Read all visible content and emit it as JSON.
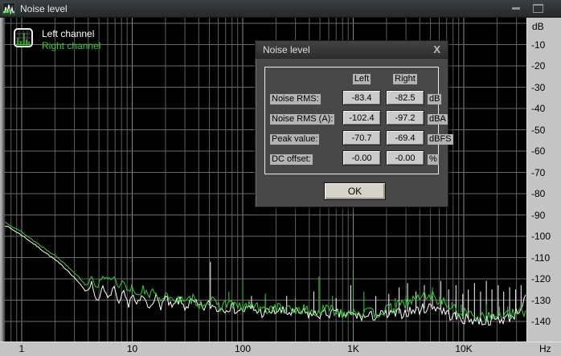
{
  "window": {
    "title": "Noise level"
  },
  "legend": {
    "left": {
      "label": "Left channel",
      "color": "#ffffff"
    },
    "right": {
      "label": "Right channel",
      "color": "#35c835"
    }
  },
  "axes": {
    "y_title": "dB",
    "y_ticks": [
      "-10",
      "-20",
      "-30",
      "-40",
      "-50",
      "-60",
      "-70",
      "-80",
      "-90",
      "-100",
      "-110",
      "-120",
      "-130",
      "-140"
    ],
    "x_ticks": [
      {
        "label": "1",
        "f": 1
      },
      {
        "label": "10",
        "f": 10
      },
      {
        "label": "100",
        "f": 100
      },
      {
        "label": "1K",
        "f": 1000
      },
      {
        "label": "10K",
        "f": 10000
      }
    ],
    "x_unit": "Hz"
  },
  "dialog": {
    "title": "Noise level",
    "close_label": "X",
    "columns": [
      "Left",
      "Right"
    ],
    "rows": [
      {
        "label": "Noise RMS:",
        "left": "-83.4",
        "right": "-82.5",
        "unit": "dB"
      },
      {
        "label": "Noise RMS (A):",
        "left": "-102.4",
        "right": "-97.2",
        "unit": "dBA"
      },
      {
        "label": "Peak value:",
        "left": "-70.7",
        "right": "-69.4",
        "unit": "dBFS"
      },
      {
        "label": "DC offset:",
        "left": "-0.00",
        "right": "-0.00",
        "unit": "%"
      }
    ],
    "ok_label": "OK"
  },
  "chart_data": {
    "type": "line",
    "title": "Noise level spectrum",
    "xlabel": "Hz",
    "ylabel": "dB",
    "x_scale": "log",
    "x_range_hz": [
      0.7,
      36500
    ],
    "y_range_db": [
      0,
      -150
    ],
    "grid": {
      "horizontal_step_db": 10,
      "vertical": "log-decades"
    },
    "legend_position": "top-left",
    "series": [
      {
        "name": "Left channel",
        "color": "#ffffff",
        "trend": [
          [
            0.72,
            -95
          ],
          [
            1,
            -99.5
          ],
          [
            1.4,
            -105
          ],
          [
            2,
            -111
          ],
          [
            2.6,
            -116
          ],
          [
            3.2,
            -121
          ],
          [
            3.8,
            -126
          ],
          [
            4.3,
            -122
          ],
          [
            4.8,
            -131
          ],
          [
            5.4,
            -124
          ],
          [
            6.1,
            -130
          ],
          [
            6.8,
            -123
          ],
          [
            7.5,
            -133
          ],
          [
            8.3,
            -126
          ],
          [
            9.2,
            -132
          ],
          [
            10,
            -127
          ],
          [
            11,
            -133
          ],
          [
            12.5,
            -128
          ],
          [
            14,
            -134
          ],
          [
            16,
            -128
          ],
          [
            18,
            -133
          ],
          [
            20,
            -129
          ],
          [
            23,
            -134
          ],
          [
            26,
            -130
          ],
          [
            30,
            -133
          ],
          [
            35,
            -131
          ],
          [
            42,
            -134
          ],
          [
            50,
            -132
          ],
          [
            60,
            -134
          ],
          [
            75,
            -133
          ],
          [
            95,
            -135
          ],
          [
            120,
            -134
          ],
          [
            150,
            -136
          ],
          [
            200,
            -135
          ],
          [
            260,
            -136
          ],
          [
            340,
            -136
          ],
          [
            450,
            -137
          ],
          [
            600,
            -136
          ],
          [
            800,
            -137
          ],
          [
            1000,
            -137
          ],
          [
            1300,
            -138
          ],
          [
            1700,
            -137
          ],
          [
            2200,
            -137
          ],
          [
            2800,
            -136
          ],
          [
            3500,
            -135
          ],
          [
            4300,
            -134
          ],
          [
            5000,
            -133
          ],
          [
            5700,
            -133
          ],
          [
            6500,
            -135
          ],
          [
            7500,
            -137
          ],
          [
            8500,
            -138
          ],
          [
            10000,
            -139
          ],
          [
            12000,
            -139
          ],
          [
            15000,
            -140
          ],
          [
            18000,
            -139
          ],
          [
            22000,
            -139
          ],
          [
            26000,
            -138
          ],
          [
            30000,
            -136
          ],
          [
            34000,
            -132
          ],
          [
            36500,
            -129
          ]
        ],
        "spikes": [
          [
            51,
            -112
          ],
          [
            120,
            -128
          ],
          [
            160,
            -129
          ],
          [
            250,
            -128
          ],
          [
            440,
            -126
          ],
          [
            700,
            -129
          ],
          [
            950,
            -123
          ],
          [
            1600,
            -128
          ],
          [
            2100,
            -127
          ],
          [
            2600,
            -124
          ],
          [
            3100,
            -122
          ],
          [
            3700,
            -126
          ],
          [
            4400,
            -123
          ],
          [
            5200,
            -127
          ],
          [
            6200,
            -121
          ],
          [
            7300,
            -125
          ],
          [
            8500,
            -123
          ],
          [
            9800,
            -127
          ],
          [
            11000,
            -125
          ],
          [
            12500,
            -122
          ],
          [
            14200,
            -126
          ],
          [
            16000,
            -121
          ],
          [
            18000,
            -125
          ],
          [
            20500,
            -123
          ],
          [
            23000,
            -126
          ],
          [
            26000,
            -124
          ],
          [
            29500,
            -125
          ],
          [
            33000,
            -123
          ]
        ]
      },
      {
        "name": "Right channel",
        "color": "#2fd02f",
        "trend": [
          [
            0.72,
            -93.5
          ],
          [
            1,
            -98
          ],
          [
            1.4,
            -103.5
          ],
          [
            2,
            -109
          ],
          [
            2.6,
            -114
          ],
          [
            3.2,
            -118.5
          ],
          [
            3.8,
            -123
          ],
          [
            4.3,
            -120
          ],
          [
            4.8,
            -124
          ],
          [
            5.4,
            -118
          ],
          [
            6.1,
            -121
          ],
          [
            6.8,
            -119
          ],
          [
            7.5,
            -125
          ],
          [
            8.3,
            -121
          ],
          [
            9.2,
            -127
          ],
          [
            10,
            -123
          ],
          [
            11,
            -128
          ],
          [
            12.5,
            -124
          ],
          [
            14,
            -129
          ],
          [
            16,
            -125
          ],
          [
            18,
            -130
          ],
          [
            20,
            -127
          ],
          [
            23,
            -131
          ],
          [
            26,
            -128
          ],
          [
            30,
            -132
          ],
          [
            35,
            -129
          ],
          [
            42,
            -132
          ],
          [
            50,
            -130
          ],
          [
            60,
            -133
          ],
          [
            75,
            -131
          ],
          [
            95,
            -134
          ],
          [
            120,
            -132
          ],
          [
            150,
            -135
          ],
          [
            200,
            -133
          ],
          [
            260,
            -135
          ],
          [
            340,
            -134
          ],
          [
            450,
            -136
          ],
          [
            600,
            -134
          ],
          [
            800,
            -136
          ],
          [
            1000,
            -135
          ],
          [
            1300,
            -136
          ],
          [
            1700,
            -136
          ],
          [
            2200,
            -134
          ],
          [
            2800,
            -132
          ],
          [
            3500,
            -130
          ],
          [
            4000,
            -128.5
          ],
          [
            4600,
            -127.5
          ],
          [
            5200,
            -128
          ],
          [
            5800,
            -129.5
          ],
          [
            6500,
            -131
          ],
          [
            7500,
            -133
          ],
          [
            8500,
            -135
          ],
          [
            10000,
            -136
          ],
          [
            12000,
            -137
          ],
          [
            15000,
            -137
          ],
          [
            18000,
            -138
          ],
          [
            22000,
            -137
          ],
          [
            26000,
            -137
          ],
          [
            30000,
            -136
          ],
          [
            34000,
            -135.5
          ],
          [
            36500,
            -135
          ]
        ],
        "spikes": [
          [
            75,
            -126
          ],
          [
            100,
            -121
          ],
          [
            160,
            -127
          ],
          [
            300,
            -129
          ],
          [
            490,
            -119
          ],
          [
            650,
            -128
          ],
          [
            1000,
            -116
          ],
          [
            1250,
            -126
          ],
          [
            2400,
            -129
          ],
          [
            3000,
            -128
          ],
          [
            5200,
            -124
          ],
          [
            7800,
            -131
          ],
          [
            9500,
            -132
          ],
          [
            16000,
            -132
          ],
          [
            21000,
            -133
          ],
          [
            25000,
            -133
          ]
        ]
      }
    ]
  }
}
